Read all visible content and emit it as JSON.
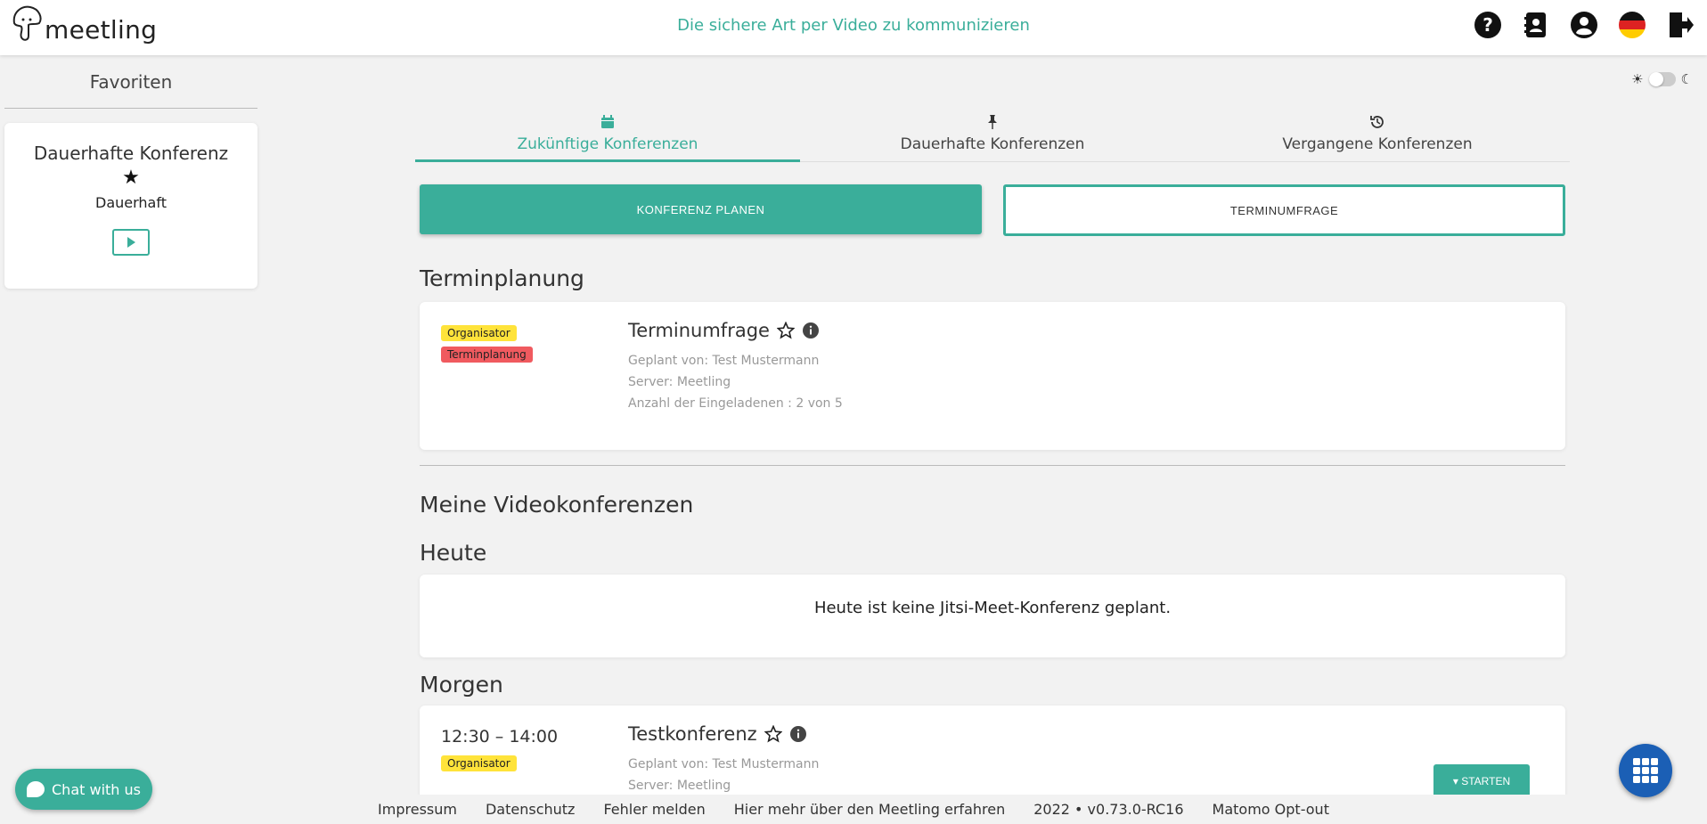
{
  "header": {
    "logo_text": "meetling",
    "tagline": "Die sichere Art per Video zu kommunizieren",
    "icons": [
      "help-icon",
      "contacts-icon",
      "user-icon",
      "german-flag-icon",
      "logout-icon"
    ]
  },
  "favorites": {
    "title": "Favoriten",
    "card": {
      "title": "Dauerhafte Konferenz",
      "subtitle": "Dauerhaft"
    }
  },
  "tabs": [
    {
      "label": "Zukünftige Konferenzen",
      "icon": "calendar-icon",
      "active": true
    },
    {
      "label": "Dauerhafte Konferenzen",
      "icon": "pin-icon",
      "active": false
    },
    {
      "label": "Vergangene Konferenzen",
      "icon": "history-icon",
      "active": false
    }
  ],
  "actions": {
    "plan_label": "KONFERENZ PLANEN",
    "poll_label": "TERMINUMFRAGE"
  },
  "scheduling": {
    "heading": "Terminplanung",
    "poll": {
      "badges": [
        "Organisator",
        "Terminplanung"
      ],
      "title": "Terminumfrage",
      "planned_by": "Geplant von: Test Mustermann",
      "server": "Server: Meetling",
      "invitees": "Anzahl der Eingeladenen : 2 von 5"
    }
  },
  "my_conferences": {
    "heading": "Meine Videokonferenzen",
    "today": {
      "heading": "Heute",
      "empty": "Heute ist keine Jitsi-Meet-Konferenz geplant."
    },
    "tomorrow": {
      "heading": "Morgen",
      "conference": {
        "time": "12:30 – 14:00",
        "badge": "Organisator",
        "title": "Testkonferenz",
        "planned_by": "Geplant von: Test Mustermann",
        "server": "Server: Meetling",
        "start_label": "▾ STARTEN"
      }
    }
  },
  "chat": {
    "label": "Chat with us"
  },
  "footer": {
    "links": [
      "Impressum",
      "Datenschutz",
      "Fehler melden",
      "Hier mehr über den Meetling erfahren",
      "2022 • v0.73.0-RC16",
      "Matomo Opt-out"
    ]
  },
  "colors": {
    "accent": "#3aae9a",
    "badge_yellow": "#ffe33a",
    "badge_red": "#f05a5f",
    "fab_blue": "#1b5fb5"
  }
}
